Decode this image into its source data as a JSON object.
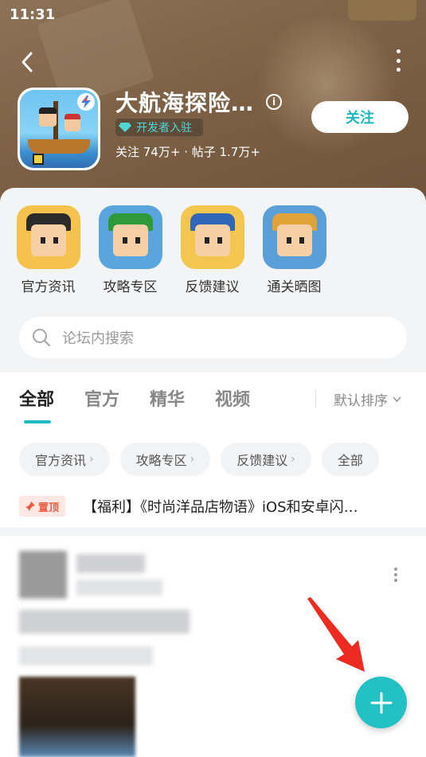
{
  "status_bar": {
    "time": "11:31"
  },
  "app": {
    "title": "大航海探险…",
    "developer_badge": "开发者入驻",
    "stats": "关注 74万+ · 帖子 1.7万+",
    "follow_label": "关注",
    "info_icon": "i"
  },
  "quick_links": [
    {
      "label": "官方资讯",
      "icon": "pirate-avatar-icon"
    },
    {
      "label": "攻略专区",
      "icon": "wizard-avatar-icon"
    },
    {
      "label": "反馈建议",
      "icon": "bandana-avatar-icon"
    },
    {
      "label": "通关晒图",
      "icon": "crown-avatar-icon"
    }
  ],
  "search": {
    "placeholder": "论坛内搜索"
  },
  "tabs": [
    {
      "label": "全部",
      "active": true
    },
    {
      "label": "官方",
      "active": false
    },
    {
      "label": "精华",
      "active": false
    },
    {
      "label": "视频",
      "active": false
    }
  ],
  "sort": {
    "label": "默认排序"
  },
  "chips": [
    {
      "label": "官方资讯",
      "chevron": "›"
    },
    {
      "label": "攻略专区",
      "chevron": "›"
    },
    {
      "label": "反馈建议",
      "chevron": "›"
    },
    {
      "label": "全部",
      "chevron": ""
    }
  ],
  "pinned": {
    "tag": "置顶",
    "title": "【福利】《时尚洋品店物语》iOS和安卓闪…"
  },
  "colors": {
    "accent": "#23c0c4",
    "pin": "#ec5a3d"
  }
}
